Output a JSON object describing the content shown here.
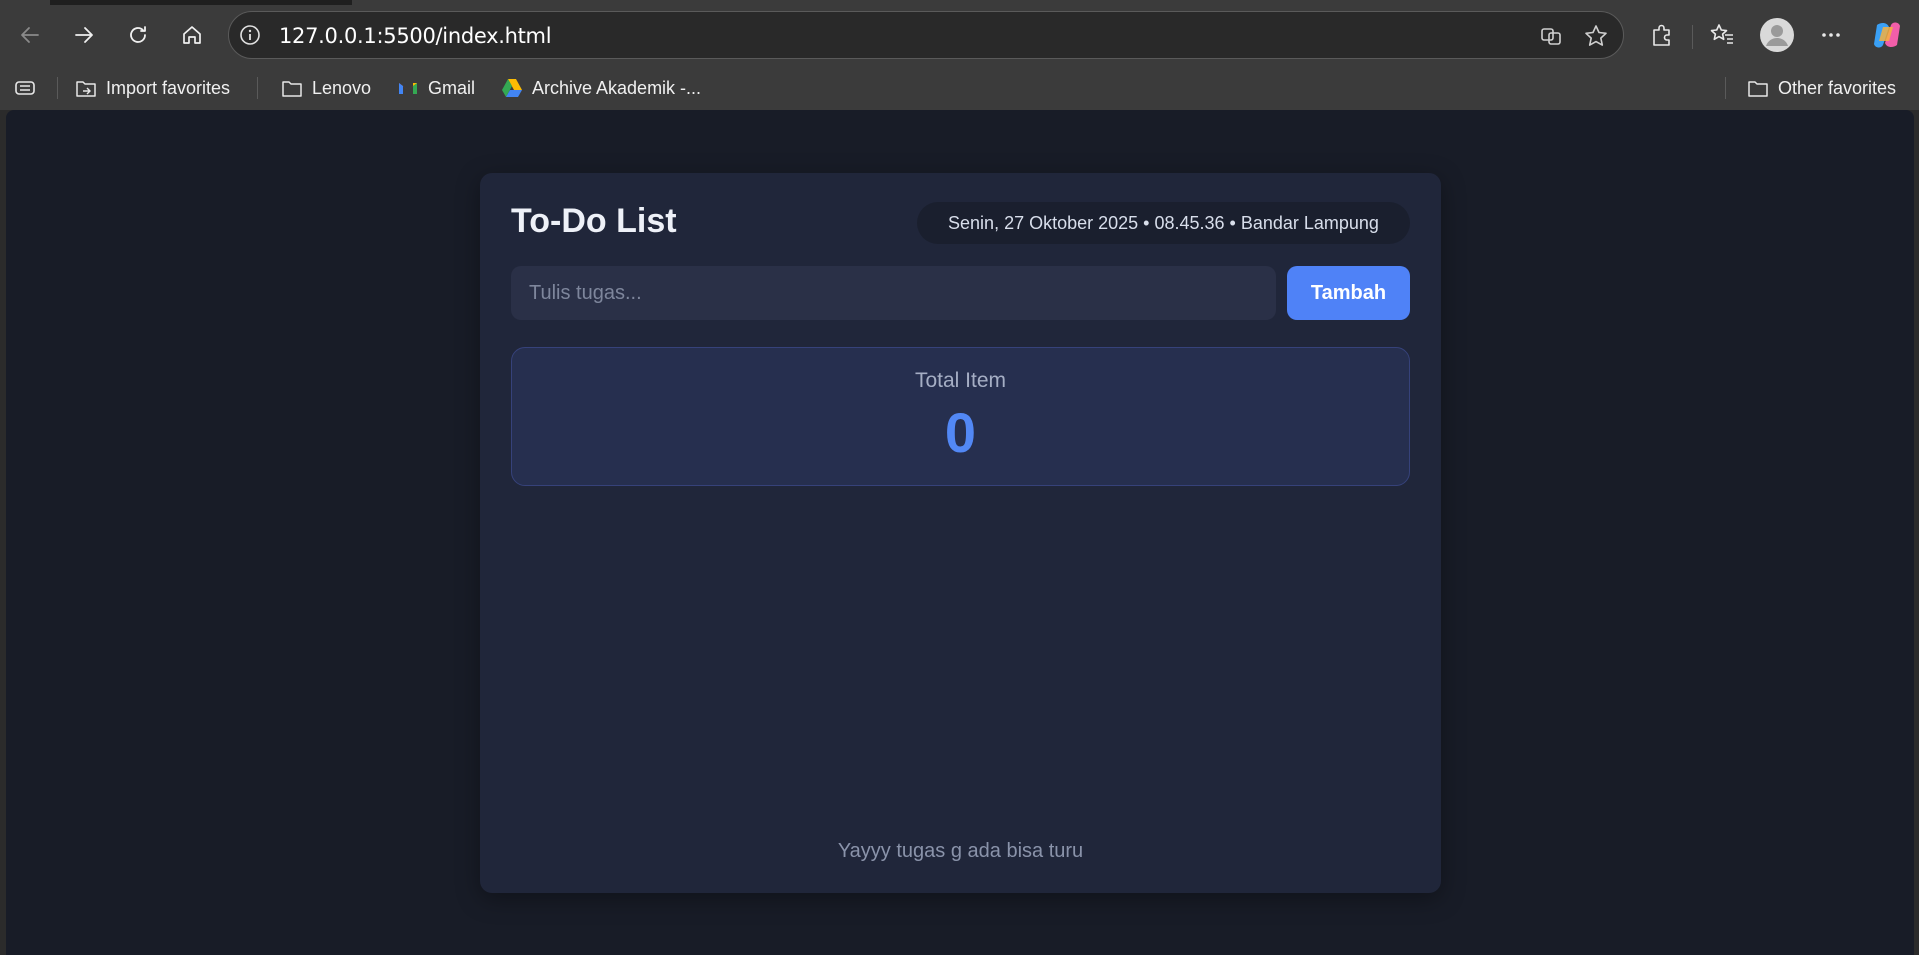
{
  "browser": {
    "url": "127.0.0.1:5500/index.html",
    "bookmarks": [
      {
        "label": "Import favorites",
        "icon": "import-icon"
      },
      {
        "label": "Lenovo",
        "icon": "folder-icon"
      },
      {
        "label": "Gmail",
        "icon": "gmail-icon"
      },
      {
        "label": "Archive Akademik -...",
        "icon": "google-drive-icon"
      }
    ],
    "other_favorites": "Other favorites"
  },
  "app": {
    "title": "To-Do List",
    "datetime": "Senin, 27 Oktober 2025 • 08.45.36 • Bandar Lampung",
    "input_placeholder": "Tulis tugas...",
    "add_button": "Tambah",
    "stats": {
      "label": "Total Item",
      "value": "0"
    },
    "empty_message": "Yayyy tugas g ada bisa turu"
  },
  "colors": {
    "page_bg": "#181c27",
    "card_bg": "#20263a",
    "accent": "#4f82f7"
  }
}
